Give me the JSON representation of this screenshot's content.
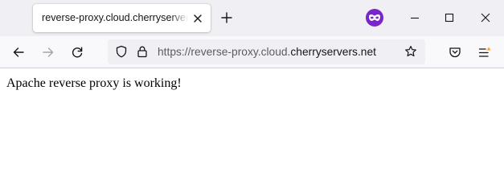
{
  "tab": {
    "title": "reverse-proxy.cloud.cherryservers.net"
  },
  "urlbar": {
    "scheme": "https://",
    "subdomain": "reverse-proxy.cloud.",
    "domain": "cherryservers.net"
  },
  "page": {
    "body_text": "Apache reverse proxy is working!"
  },
  "icons": {
    "tab_close": "close-icon",
    "new_tab": "plus-icon",
    "private_browsing": "private-browsing-icon",
    "minimize": "minimize-icon",
    "maximize": "maximize-icon",
    "window_close": "close-icon",
    "back": "arrow-left-icon",
    "forward": "arrow-right-icon",
    "reload": "reload-icon",
    "tracking_protection": "shield-icon",
    "security": "lock-icon",
    "bookmark": "star-icon",
    "pocket": "pocket-icon",
    "app_menu": "hamburger-menu-icon"
  },
  "colors": {
    "tabstrip_bg": "#f0f0f4",
    "navbar_bg": "#f9f9fb",
    "private_accent": "#7a25c9",
    "menu_badge": "#ffa436",
    "text_primary": "#15141a",
    "text_secondary": "#5b5b66"
  }
}
